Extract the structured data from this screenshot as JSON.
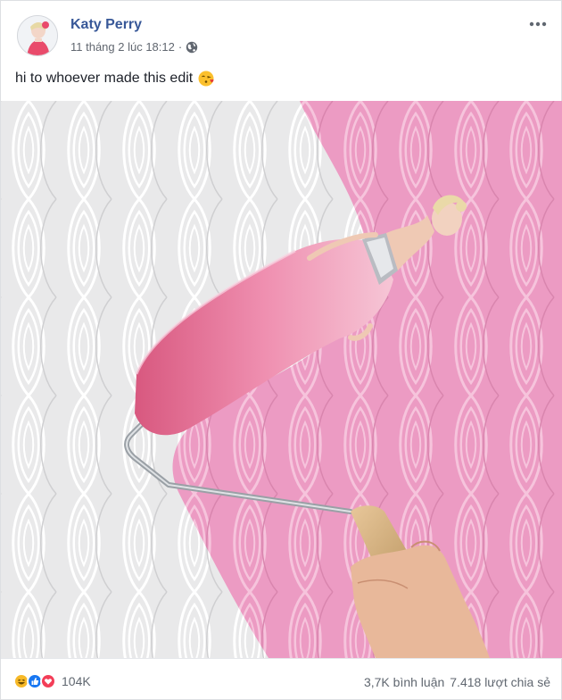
{
  "post": {
    "author": "Katy Perry",
    "timestamp": "11 tháng 2 lúc 18:12",
    "privacy_icon": "globe-icon",
    "options_icon": "more-options-icon",
    "caption": "hi to whoever made this edit",
    "caption_emoji": "kissing-heart-emoji-icon"
  },
  "footer": {
    "reaction_icons": [
      "haha-icon",
      "like-icon",
      "love-icon"
    ],
    "reaction_count": "104K",
    "comments": "3,7K bình luận",
    "shares": "7.418 lượt chia sẻ"
  },
  "colors": {
    "author_link": "#385898",
    "wall_pink": "#ec9bc3",
    "wall_white": "#e9e9ea",
    "like_blue": "#1877f2",
    "love_red": "#f33e58",
    "haha_yellow": "#f7b928"
  }
}
